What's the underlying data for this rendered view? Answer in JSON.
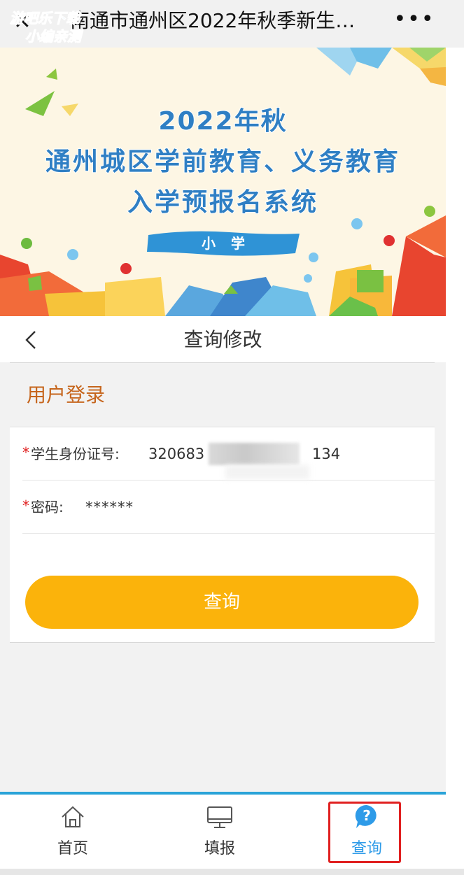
{
  "topbar": {
    "close_icon": "close-icon",
    "title": "南通市通州区2022年秋季新生…",
    "more_label": "•••",
    "watermark_line1": "游吧乐下载",
    "watermark_line2": "小编亲测"
  },
  "banner": {
    "line1": "2022年秋",
    "line2": "通州城区学前教育、义务教育",
    "line3": "入学预报名系统",
    "tag": "小学"
  },
  "page": {
    "back_icon": "chevron-left-icon",
    "title": "查询修改"
  },
  "login": {
    "title": "用户登录",
    "required_mark": "*",
    "id_label": "学生身份证号:",
    "id_value_prefix": "320683",
    "id_value_suffix": "134",
    "password_label": "密码:",
    "password_value": "******",
    "submit_label": "查询"
  },
  "nav": {
    "items": [
      {
        "label": "首页",
        "icon": "home-icon"
      },
      {
        "label": "填报",
        "icon": "monitor-icon"
      },
      {
        "label": "查询",
        "icon": "question-bubble-icon"
      }
    ]
  },
  "colors": {
    "accent": "#fbb30b",
    "active_nav": "#2e9be8",
    "login_title": "#c6651c",
    "required": "#e02020",
    "highlight_box": "#e02020",
    "nav_top_line": "#2aa3d8"
  }
}
